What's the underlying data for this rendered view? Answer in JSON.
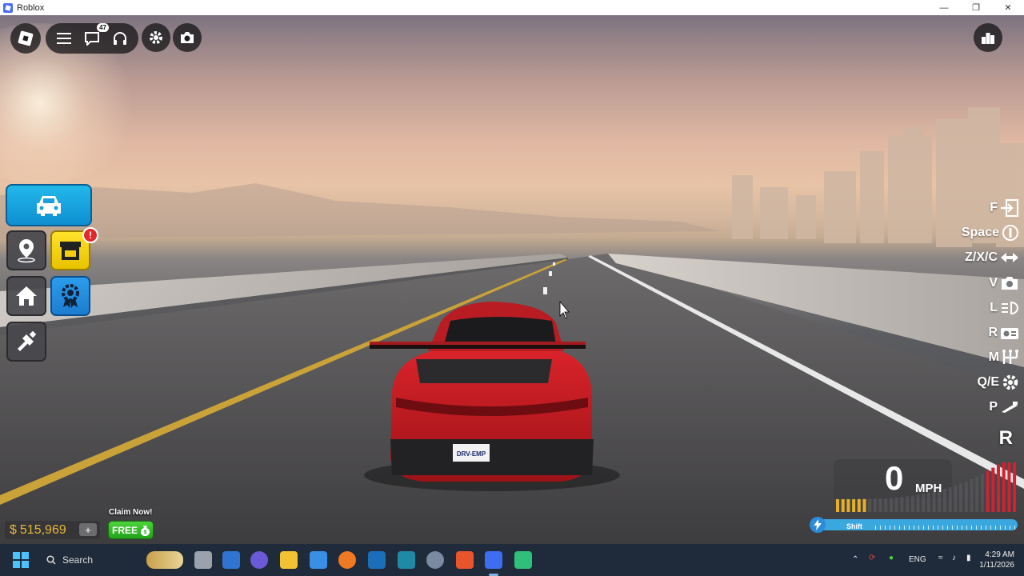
{
  "window": {
    "title": "Roblox",
    "controls": [
      "minimize-icon",
      "restore-icon",
      "close-icon"
    ]
  },
  "top_hud": {
    "chat_unread_count": "47",
    "icons": [
      "roblox-logo-icon",
      "hamburger-menu-icon",
      "chat-icon",
      "voice-headset-icon",
      "gear-icon",
      "camera-icon",
      "leaderboard-icon"
    ]
  },
  "side_menu": {
    "shop_alert_badge": "!",
    "buttons": [
      "vehicle-icon",
      "location-pin-icon",
      "shop-icon",
      "home-icon",
      "rewards-badge-icon",
      "customize-icon"
    ]
  },
  "key_hints": [
    {
      "key": "F",
      "icon": "exit-vehicle-icon"
    },
    {
      "key": "Space",
      "icon": "brake-icon"
    },
    {
      "key": "Z/X/C",
      "icon": "indicator-arrows-icon"
    },
    {
      "key": "V",
      "icon": "camera-icon"
    },
    {
      "key": "L",
      "icon": "headlight-icon"
    },
    {
      "key": "R",
      "icon": "radio-icon"
    },
    {
      "key": "M",
      "icon": "manual-gearbox-icon"
    },
    {
      "key": "Q/E",
      "icon": "gear-shift-icon"
    },
    {
      "key": "P",
      "icon": "handbrake-icon"
    }
  ],
  "dashboard": {
    "gear": "R",
    "speed": "0",
    "speed_unit": "MPH",
    "boost_label": "Shift",
    "boost_fraction": 0.0,
    "rpm_level_fraction": 0.2,
    "colors": {
      "boost": "#5ec8f5",
      "rpm_low": "#e2b02a",
      "rpm_high": "#d02230"
    }
  },
  "wallet": {
    "currency_symbol": "$",
    "balance": "515,969",
    "add_label": "+"
  },
  "promo": {
    "caption": "Claim Now!",
    "button_label": "FREE"
  },
  "scene": {
    "license_plate": "DRV-EMP"
  },
  "taskbar": {
    "search_placeholder": "Search",
    "language": "ENG",
    "time": "4:29 AM",
    "date": "1/11/2026",
    "apps": [
      "widgets-icon",
      "task-view-icon",
      "edge-icon",
      "discord-icon",
      "file-explorer-icon",
      "microsoft-store-icon",
      "firefox-icon",
      "app-shield-icon",
      "app-book-icon",
      "settings-gear-icon",
      "brave-icon",
      "roblox-icon",
      "roblox-studio-icon"
    ]
  }
}
